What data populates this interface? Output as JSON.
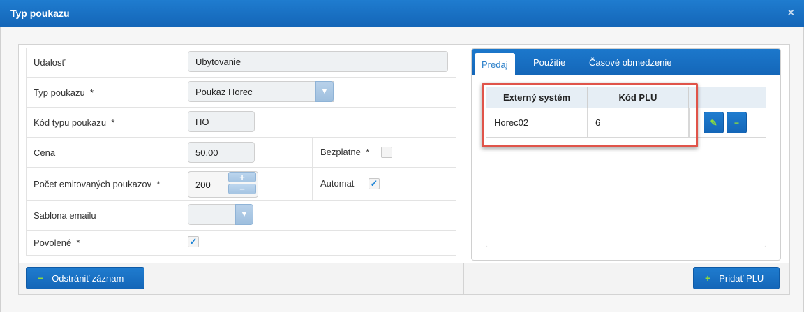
{
  "dialog": {
    "title": "Typ poukazu",
    "close_glyph": "×"
  },
  "form": {
    "udalost": {
      "label": "Udalosť",
      "value": "Ubytovanie"
    },
    "typ_poukazu": {
      "label": "Typ poukazu",
      "value": "Poukaz Horec",
      "required": "*"
    },
    "kod_typu": {
      "label": "Kód typu poukazu",
      "value": "HO",
      "required": "*"
    },
    "cena": {
      "label": "Cena",
      "value": "50,00"
    },
    "bezplatne": {
      "label": "Bezplatne",
      "required": "*",
      "checked": false
    },
    "pocet": {
      "label": "Počet emitovaných poukazov",
      "value": "200",
      "required": "*",
      "plus": "+",
      "minus": "−"
    },
    "automat": {
      "label": "Automat",
      "checked": true,
      "check_glyph": "✓"
    },
    "sablona": {
      "label": "Sablona emailu",
      "value": ""
    },
    "povolene": {
      "label": "Povolené",
      "required": "*",
      "checked": true,
      "check_glyph": "✓"
    }
  },
  "tabs": [
    {
      "label": "Predaj",
      "active": true
    },
    {
      "label": "Použitie",
      "active": false
    },
    {
      "label": "Časové obmedzenie",
      "active": false
    }
  ],
  "plu_table": {
    "columns": [
      "Externý systém",
      "Kód PLU"
    ],
    "rows": [
      {
        "system": "Horec02",
        "kod": "6"
      }
    ],
    "edit_glyph": "✎",
    "remove_glyph": "−"
  },
  "footer": {
    "remove_button": {
      "icon": "−",
      "label": "Odstrániť záznam"
    },
    "add_plu_button": {
      "icon": "+",
      "label": "Pridať PLU"
    }
  },
  "colors": {
    "accent": "#1b75c9",
    "highlight": "#e0544a",
    "icon_green": "#8fdc3a"
  }
}
